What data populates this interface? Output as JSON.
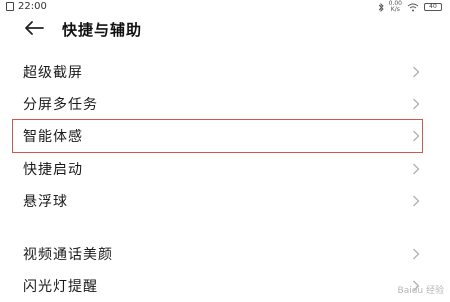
{
  "status_bar": {
    "time": "22:00",
    "network_speed": "0.00\nK/s",
    "battery_level": "40"
  },
  "header": {
    "title": "快捷与辅助"
  },
  "items": [
    {
      "label": "超级截屏"
    },
    {
      "label": "分屏多任务"
    },
    {
      "label": "智能体感",
      "highlighted": true
    },
    {
      "label": "快捷启动"
    },
    {
      "label": "悬浮球"
    },
    {
      "label": "视频通话美颜"
    },
    {
      "label": "闪光灯提醒"
    }
  ],
  "watermark": "Baidu 经验",
  "colors": {
    "highlight": "#d9534f",
    "chevron": "#b0b0b0"
  },
  "icons": {
    "back": "back-arrow-icon",
    "chevron": "chevron-right-icon"
  }
}
